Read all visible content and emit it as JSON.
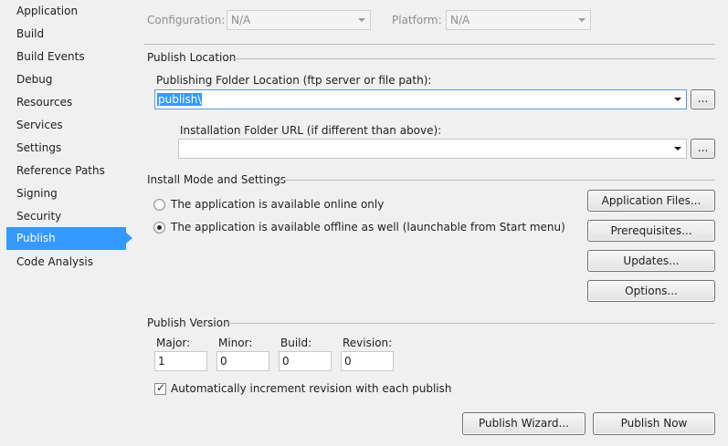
{
  "sidebar": {
    "items": [
      {
        "label": "Application"
      },
      {
        "label": "Build"
      },
      {
        "label": "Build Events"
      },
      {
        "label": "Debug"
      },
      {
        "label": "Resources"
      },
      {
        "label": "Services"
      },
      {
        "label": "Settings"
      },
      {
        "label": "Reference Paths"
      },
      {
        "label": "Signing"
      },
      {
        "label": "Security"
      },
      {
        "label": "Publish",
        "active": true
      },
      {
        "label": "Code Analysis"
      }
    ]
  },
  "top": {
    "configuration_label": "Configuration:",
    "configuration_value": "N/A",
    "platform_label": "Platform:",
    "platform_value": "N/A"
  },
  "publish_location": {
    "heading": "Publish Location",
    "folder_label": "Publishing Folder Location (ftp server or file path):",
    "folder_value": "publish\\",
    "browse_label": "...",
    "install_url_label": "Installation Folder URL (if different than above):",
    "install_url_value": "",
    "install_browse_label": "..."
  },
  "install_mode": {
    "heading": "Install Mode and Settings",
    "online_label": "The application is available online only",
    "offline_label": "The application is available offline as well (launchable from Start menu)",
    "selected": "offline",
    "buttons": {
      "application_files": "Application Files...",
      "prerequisites": "Prerequisites...",
      "updates": "Updates...",
      "options": "Options..."
    }
  },
  "publish_version": {
    "heading": "Publish Version",
    "major_label": "Major:",
    "major_value": "1",
    "minor_label": "Minor:",
    "minor_value": "0",
    "build_label": "Build:",
    "build_value": "0",
    "revision_label": "Revision:",
    "revision_value": "0",
    "auto_increment_label": "Automatically increment revision with each publish",
    "auto_increment_checked": true
  },
  "footer": {
    "wizard_label": "Publish Wizard...",
    "publish_now_label": "Publish Now"
  },
  "colors": {
    "selection": "#3399ff",
    "background": "#f0f0f0"
  }
}
